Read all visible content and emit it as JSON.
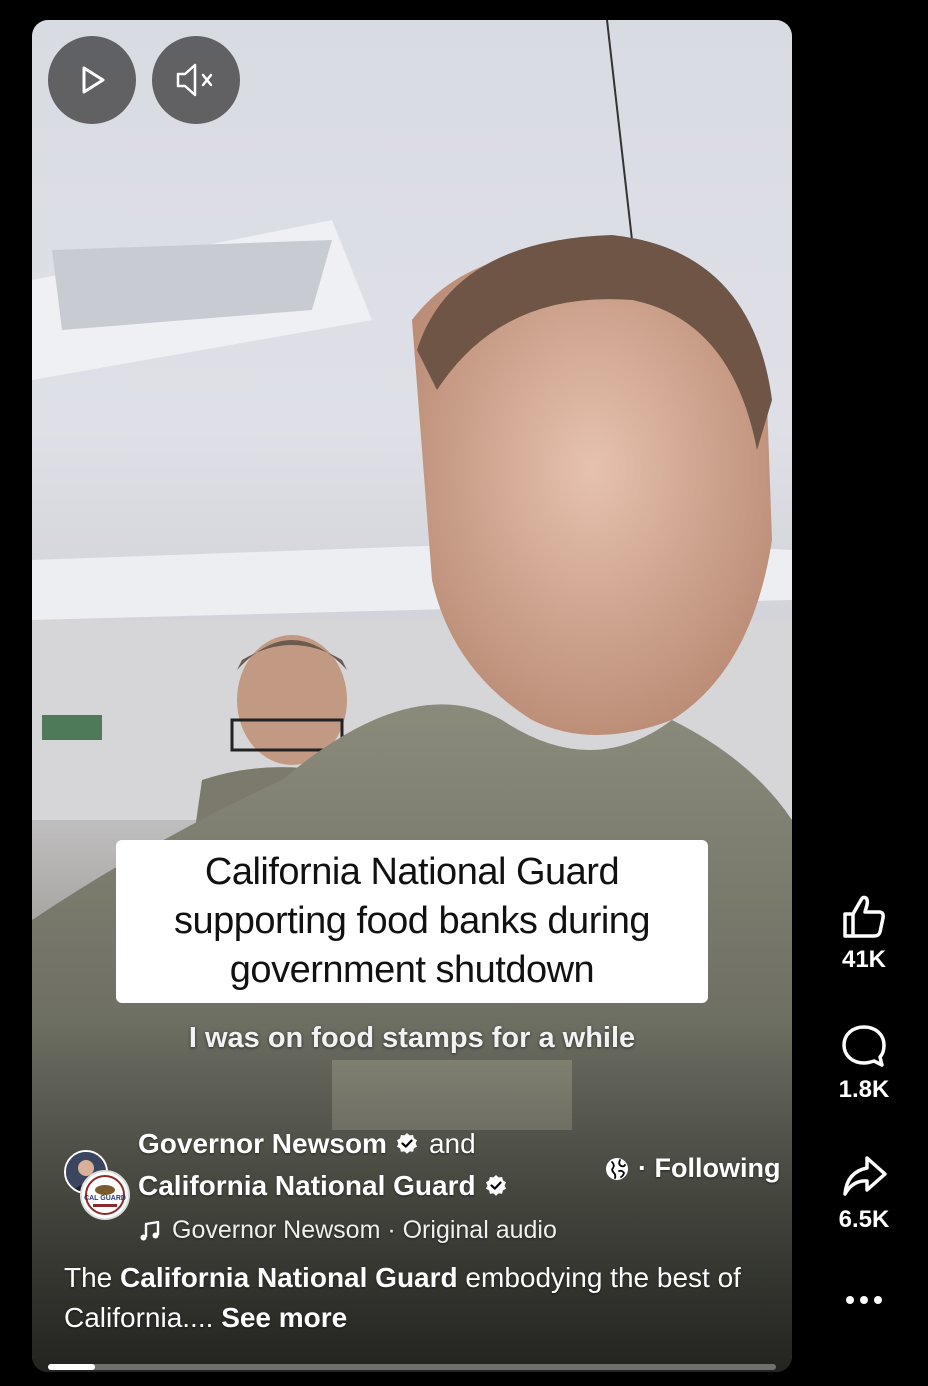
{
  "video": {
    "play_icon": "play-icon",
    "mute_icon": "muted-speaker-icon",
    "caption": "California National Guard supporting food banks during government shutdown",
    "subtitle": "I was on food stamps for a while",
    "progress": 0.065
  },
  "post": {
    "author_primary": "Governor Newsom",
    "conjunction": "and",
    "author_secondary": "California National Guard",
    "globe_icon": "globe-icon",
    "follow_status": "· Following",
    "audio": "Governor Newsom · Original audio",
    "description_prefix": "The ",
    "description_bold": "California National Guard",
    "description_rest": " embodying the best of California....",
    "see_more": "See more",
    "avatar_badge_text": "CAL GUARD"
  },
  "actions": {
    "like_count": "41K",
    "comment_count": "1.8K",
    "share_count": "6.5K",
    "more_icon": "more-horizontal-icon"
  },
  "colors": {
    "background": "#000000",
    "caption_bg": "#ffffff",
    "verified": "#ffffff"
  }
}
